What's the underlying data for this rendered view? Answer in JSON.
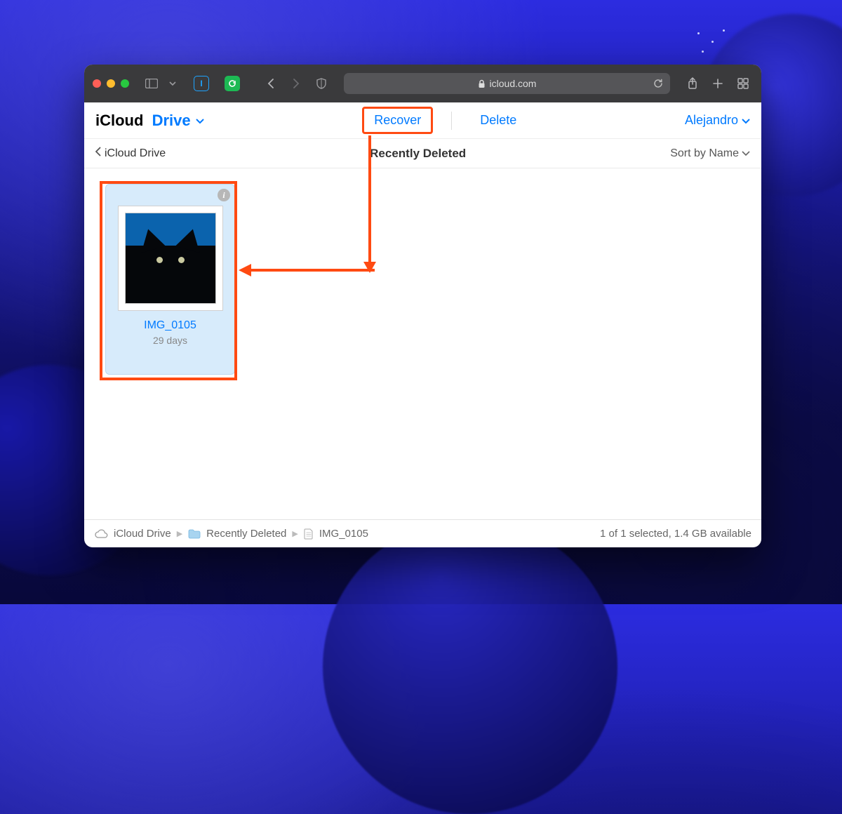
{
  "browser": {
    "url_host": "icloud.com"
  },
  "header": {
    "title_bold": "iCloud",
    "title_drive": "Drive",
    "actions": {
      "recover": "Recover",
      "delete": "Delete"
    },
    "user": "Alejandro"
  },
  "subheader": {
    "back_label": "iCloud Drive",
    "page_title": "Recently Deleted",
    "sort_label": "Sort by Name"
  },
  "files": [
    {
      "name": "IMG_0105",
      "subtitle": "29 days"
    }
  ],
  "footer": {
    "crumbs": [
      "iCloud Drive",
      "Recently Deleted",
      "IMG_0105"
    ],
    "status": "1 of 1 selected, 1.4 GB available"
  }
}
